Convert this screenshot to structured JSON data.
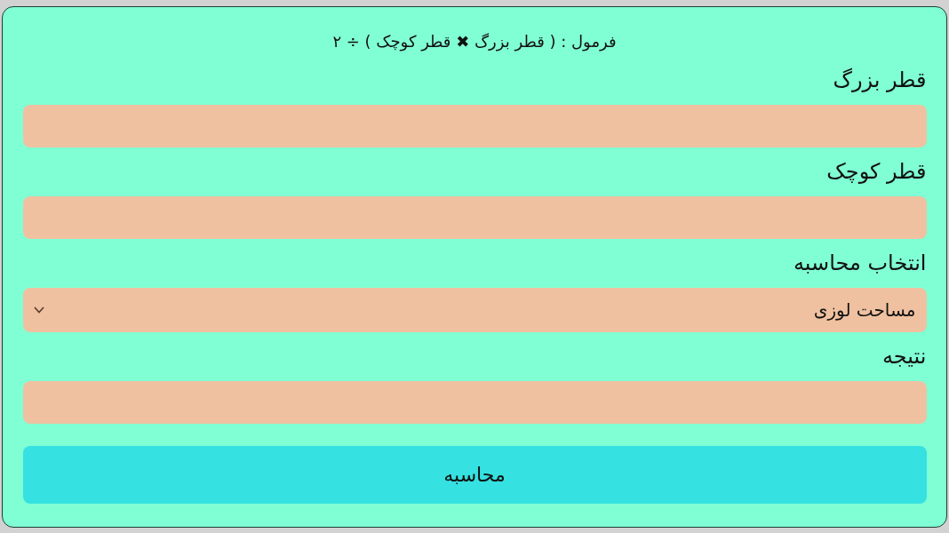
{
  "formula": "فرمول : ( قطر بزرگ ✖ قطر کوچک ) ÷ ۲",
  "fields": [
    {
      "kind": "input",
      "label": "قطر بزرگ"
    },
    {
      "kind": "input",
      "label": "قطر کوچک"
    },
    {
      "kind": "select",
      "label": "انتخاب محاسبه",
      "value": "مساحت لوزی"
    },
    {
      "kind": "input",
      "label": "نتیجه"
    }
  ],
  "button": "محاسبه"
}
